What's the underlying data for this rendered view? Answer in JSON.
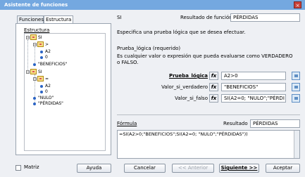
{
  "window": {
    "title": "Asistente de funciones"
  },
  "tabs": [
    {
      "label": "Funciones"
    },
    {
      "label": "Estructura"
    }
  ],
  "structure": {
    "label": "Estructura",
    "tree": [
      {
        "text": "SI"
      },
      {
        "text": ">"
      },
      {
        "text": "A2"
      },
      {
        "text": "0"
      },
      {
        "text": "\"BENEFICIOS\""
      },
      {
        "text": "SI"
      },
      {
        "text": "="
      },
      {
        "text": "A2"
      },
      {
        "text": "0"
      },
      {
        "text": "\"NULO\""
      },
      {
        "text": "\"PÉRDIDAS\""
      }
    ]
  },
  "function": {
    "name": "SI",
    "result_label": "Resultado de función",
    "result_value": "PÉRDIDAS",
    "description": "Especifica una prueba lógica que se desea efectuar.",
    "arg_title": "Prueba_lógica (requerido)",
    "arg_description": "Es cualquier valor o expresión que pueda evaluarse como VERDADERO o FALSO."
  },
  "args": [
    {
      "label": "Prueba_lógica",
      "value": "A2>0"
    },
    {
      "label": "Valor_si_verdadero",
      "value": "\"BENEFICIOS\""
    },
    {
      "label": "Valor_si_falso",
      "value": "SI(A2=0; \"NULO\";\"PÉRDI"
    }
  ],
  "formula": {
    "label": "Fórmula",
    "result_label": "Resultado",
    "result_value": "PÉRDIDAS",
    "text": "=SI(A2>0;\"BENEFICIOS\";SI(A2=0; \"NULO\";\"PÉRDIDAS\"))"
  },
  "footer": {
    "matrix_label": "Matriz",
    "help": "Ayuda",
    "cancel": "Cancelar",
    "back": "<< Anterior",
    "next": "Siguiente >>",
    "accept": "Aceptar"
  }
}
